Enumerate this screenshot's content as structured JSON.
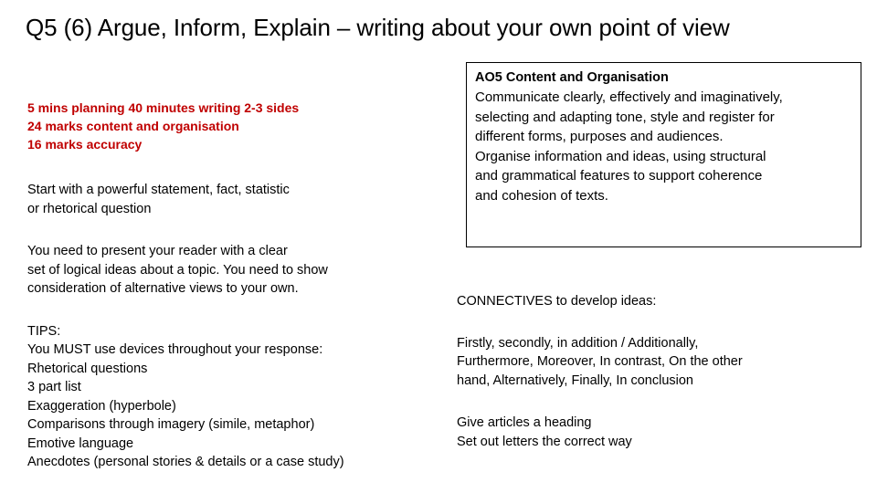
{
  "slide": {
    "title": "Q5 (6) Argue, Inform, Explain – writing about your own point of view",
    "accent_red": "#C00000",
    "text_color": "#000000",
    "background": "#ffffff"
  },
  "left_column": {
    "timing_block": {
      "color": "#C00000",
      "lines": [
        "5 mins planning 40 minutes writing 2-3 sides",
        "24 marks content and organisation",
        "16 marks accuracy"
      ]
    },
    "opening_block": {
      "lines": [
        "Start with a powerful statement, fact, statistic",
        "or rhetorical question"
      ]
    },
    "purpose_block": {
      "lines": [
        "You need to present your reader with a clear",
        "set of logical ideas about a topic. You need to show",
        "consideration of alternative views to your own."
      ]
    },
    "tips_block": {
      "lines": [
        "TIPS:",
        "You MUST use devices throughout your response:",
        "Rhetorical questions",
        "3 part list",
        "Exaggeration (hyperbole)",
        "Comparisons through imagery (simile, metaphor)",
        "Emotive language",
        "Anecdotes (personal stories & details or a case study)"
      ]
    }
  },
  "right_column": {
    "ao5_box": {
      "heading": "AO5 Content and Organisation",
      "body_lines": [
        "Communicate clearly, effectively and imaginatively,",
        "selecting and adapting tone, style and register for",
        "different forms, purposes and audiences.",
        "Organise information and ideas, using structural",
        "and grammatical features to support coherence",
        "and cohesion of texts."
      ]
    },
    "connectives_heading": "CONNECTIVES to develop ideas:",
    "connectives_lines": [
      "Firstly, secondly, in addition / Additionally,",
      "Furthermore, Moreover, In contrast, On the other",
      "hand, Alternatively, Finally, In conclusion"
    ],
    "format_lines": [
      "Give articles a heading",
      "Set out letters the correct way"
    ]
  }
}
